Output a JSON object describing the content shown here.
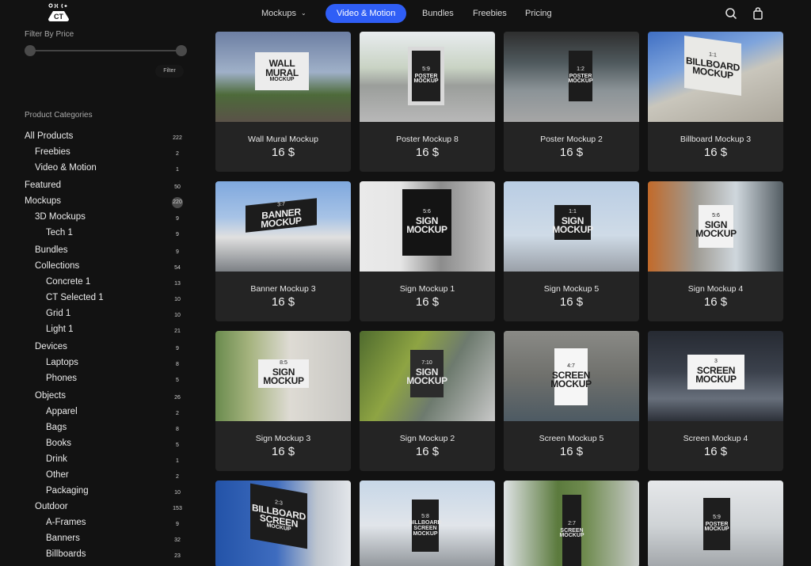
{
  "header": {
    "logo_text": "CT",
    "nav": [
      {
        "label": "Mockups",
        "has_dropdown": true,
        "active": false
      },
      {
        "label": "Video & Motion",
        "active": true
      },
      {
        "label": "Bundles",
        "active": false
      },
      {
        "label": "Freebies",
        "active": false
      },
      {
        "label": "Pricing",
        "active": false
      }
    ],
    "icons": [
      "search-icon",
      "shopping-bag-icon"
    ],
    "accent_color": "#2f5ef6"
  },
  "sidebar": {
    "filter_heading": "Filter By Price",
    "price_slider": {
      "min_position": 0,
      "max_position": 1
    },
    "filter_button": "Filter",
    "categories_heading": "Product Categories",
    "categories": [
      {
        "label": "All Products",
        "count": "222",
        "level": 0
      },
      {
        "label": "Freebies",
        "count": "2",
        "level": 1
      },
      {
        "label": "Video & Motion",
        "count": "1",
        "level": 1
      },
      {
        "label": "Featured",
        "count": "50",
        "level": 0
      },
      {
        "label": "Mockups",
        "count": "220",
        "level": 0,
        "highlighted": true
      },
      {
        "label": "3D Mockups",
        "count": "9",
        "level": 1
      },
      {
        "label": "Tech 1",
        "count": "9",
        "level": 2
      },
      {
        "label": "Bundles",
        "count": "9",
        "level": 1
      },
      {
        "label": "Collections",
        "count": "54",
        "level": 1
      },
      {
        "label": "Concrete 1",
        "count": "13",
        "level": 2
      },
      {
        "label": "CT Selected 1",
        "count": "10",
        "level": 2
      },
      {
        "label": "Grid 1",
        "count": "10",
        "level": 2
      },
      {
        "label": "Light 1",
        "count": "21",
        "level": 2
      },
      {
        "label": "Devices",
        "count": "9",
        "level": 1
      },
      {
        "label": "Laptops",
        "count": "8",
        "level": 2
      },
      {
        "label": "Phones",
        "count": "5",
        "level": 2
      },
      {
        "label": "Objects",
        "count": "26",
        "level": 1
      },
      {
        "label": "Apparel",
        "count": "2",
        "level": 2
      },
      {
        "label": "Bags",
        "count": "8",
        "level": 2
      },
      {
        "label": "Books",
        "count": "5",
        "level": 2
      },
      {
        "label": "Drink",
        "count": "1",
        "level": 2
      },
      {
        "label": "Other",
        "count": "2",
        "level": 2
      },
      {
        "label": "Packaging",
        "count": "10",
        "level": 2
      },
      {
        "label": "Outdoor",
        "count": "153",
        "level": 1
      },
      {
        "label": "A-Frames",
        "count": "9",
        "level": 2
      },
      {
        "label": "Banners",
        "count": "32",
        "level": 2
      },
      {
        "label": "Billboards",
        "count": "23",
        "level": 2
      }
    ]
  },
  "products": [
    {
      "title": "Wall Mural Mockup",
      "price": "16 $",
      "thumb": {
        "ratio": "",
        "line1": "WALL",
        "line2": "MURAL",
        "line3": "MOCKUP",
        "scene": "mural"
      }
    },
    {
      "title": "Poster Mockup 8",
      "price": "16 $",
      "thumb": {
        "ratio": "5:9",
        "line1": "POSTER",
        "line2": "MOCKUP",
        "scene": "poster-pillar"
      }
    },
    {
      "title": "Poster Mockup 2",
      "price": "16 $",
      "thumb": {
        "ratio": "1:2",
        "line1": "POSTER",
        "line2": "MOCKUP",
        "scene": "poster-kiosk"
      }
    },
    {
      "title": "Billboard Mockup 3",
      "price": "16 $",
      "thumb": {
        "ratio": "1:1",
        "line1": "BILLBOARD",
        "line2": "MOCKUP",
        "scene": "billboard"
      }
    },
    {
      "title": "Banner Mockup 3",
      "price": "16 $",
      "thumb": {
        "ratio": "3:7",
        "line1": "BANNER MOCKUP",
        "scene": "banner"
      }
    },
    {
      "title": "Sign Mockup 1",
      "price": "16 $",
      "thumb": {
        "ratio": "5:6",
        "line1": "SIGN",
        "line2": "MOCKUP",
        "scene": "sign-dark"
      }
    },
    {
      "title": "Sign Mockup 5",
      "price": "16 $",
      "thumb": {
        "ratio": "1:1",
        "line1": "SIGN",
        "line2": "MOCKUP",
        "scene": "sign-wires"
      }
    },
    {
      "title": "Sign Mockup 4",
      "price": "16 $",
      "thumb": {
        "ratio": "5:6",
        "line1": "SIGN",
        "line2": "MOCKUP",
        "scene": "sign-white"
      }
    },
    {
      "title": "Sign Mockup 3",
      "price": "16 $",
      "thumb": {
        "ratio": "8:5",
        "line1": "SIGN MOCKUP",
        "scene": "sign-street"
      }
    },
    {
      "title": "Sign Mockup 2",
      "price": "16 $",
      "thumb": {
        "ratio": "7:10",
        "line1": "SIGN",
        "line2": "MOCKUP",
        "scene": "sign-tree"
      }
    },
    {
      "title": "Screen Mockup 5",
      "price": "16 $",
      "thumb": {
        "ratio": "4:7",
        "line1": "SCREEN",
        "line2": "MOCKUP",
        "scene": "screen-station"
      }
    },
    {
      "title": "Screen Mockup 4",
      "price": "16 $",
      "thumb": {
        "ratio": "3",
        "line1": "SCREEN",
        "line2": "MOCKUP",
        "scene": "screen-hall"
      }
    },
    {
      "title": "",
      "price": "",
      "thumb": {
        "ratio": "2:3",
        "line1": "BILLBOARD",
        "line2": "SCREEN",
        "line3": "MOCKUP",
        "scene": "billboard-screen"
      }
    },
    {
      "title": "",
      "price": "",
      "thumb": {
        "ratio": "5:8",
        "line1": "BILLBOARD",
        "line2": "SCREEN",
        "line3": "MOCKUP",
        "scene": "screen-city"
      }
    },
    {
      "title": "",
      "price": "",
      "thumb": {
        "ratio": "2:7",
        "line1": "SCREEN",
        "line2": "MOCKUP",
        "scene": "screen-palm"
      }
    },
    {
      "title": "",
      "price": "",
      "thumb": {
        "ratio": "5:9",
        "line1": "POSTER",
        "line2": "MOCKUP",
        "scene": "poster-street"
      }
    }
  ]
}
